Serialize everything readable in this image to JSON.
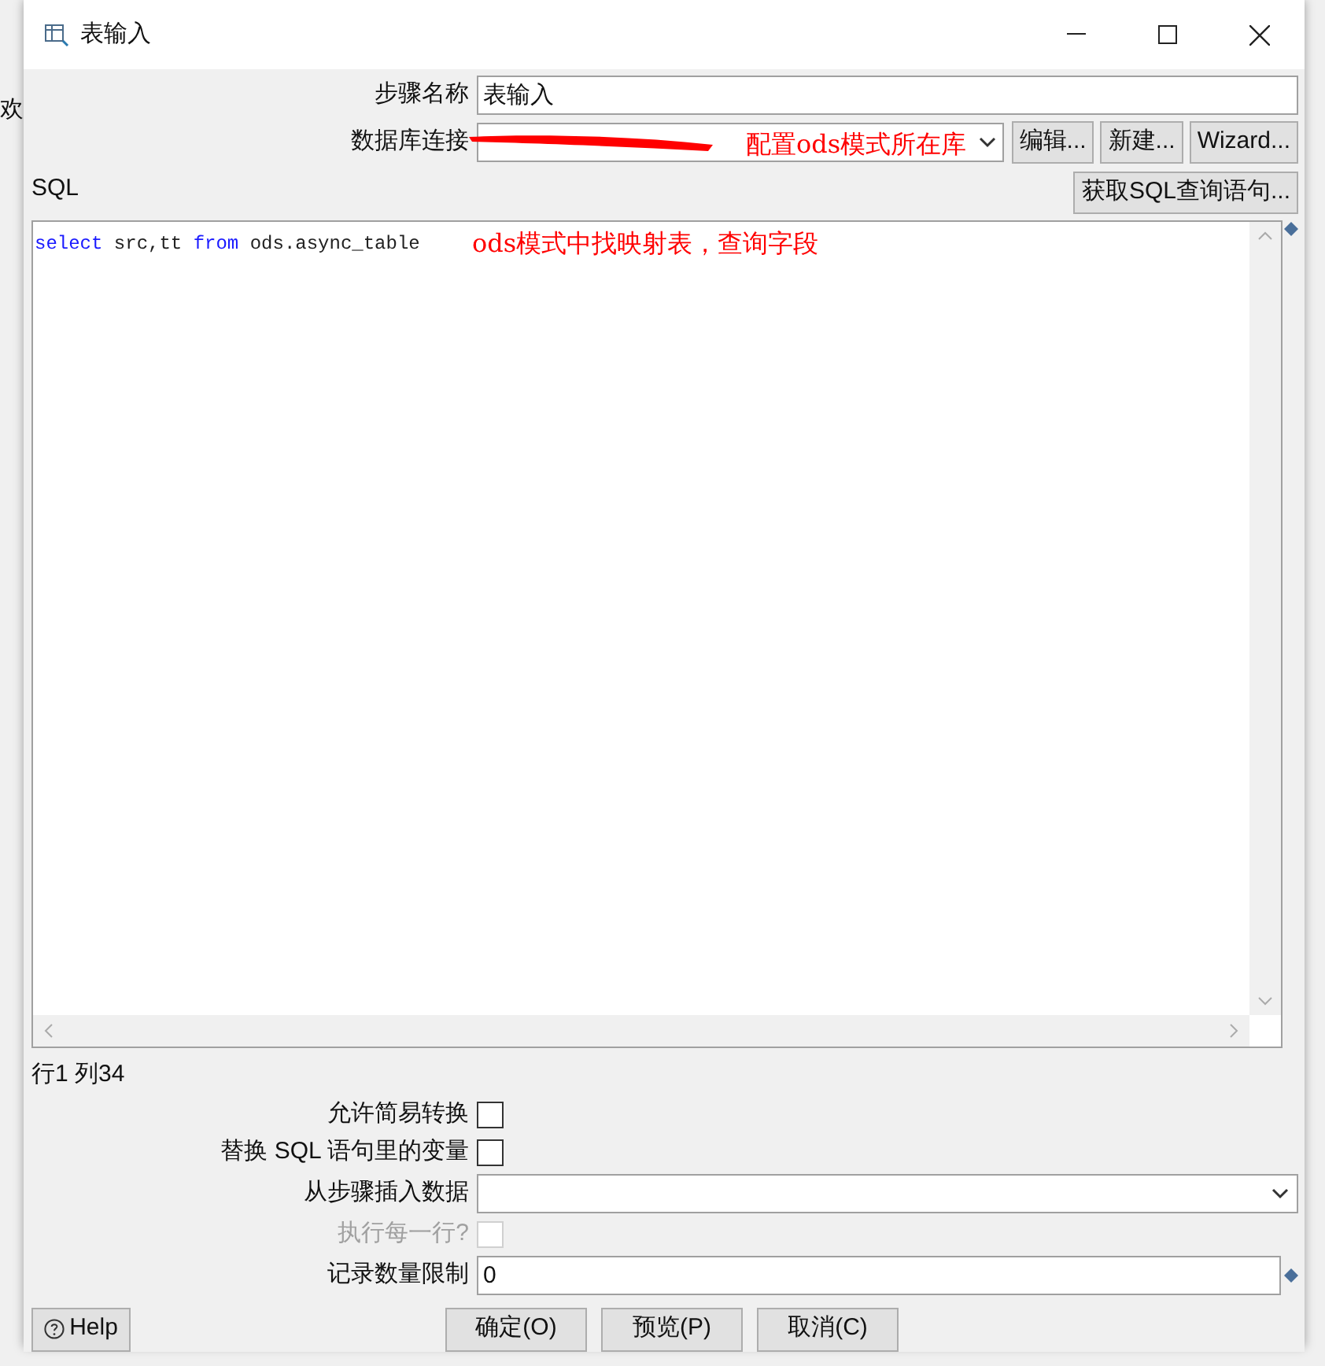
{
  "background": {
    "tab_label": "欢"
  },
  "window": {
    "title": "表输入",
    "controls": [
      {
        "kind": "minimize"
      },
      {
        "kind": "maximize"
      },
      {
        "kind": "close"
      }
    ]
  },
  "step_name": {
    "label": "步骤名称",
    "value": "表输入"
  },
  "connection": {
    "label": "数据库连接",
    "redacted": true,
    "annotation": "配置ods模式所在库",
    "buttons": [
      "编辑...",
      "新建...",
      "Wizard..."
    ]
  },
  "sql": {
    "label": "SQL",
    "get_button": "获取SQL查询语句...",
    "tokens": [
      {
        "kind": "keyword",
        "text": "select"
      },
      {
        "kind": "plain",
        "text": " src,tt "
      },
      {
        "kind": "keyword",
        "text": "from"
      },
      {
        "kind": "plain",
        "text": " ods.async_table"
      }
    ],
    "annotation": "ods模式中找映射表，查询字段"
  },
  "cursor_position": "行1 列34",
  "options": [
    {
      "kind": "checkbox",
      "label": "允许简易转换",
      "checked": false,
      "disabled": false
    },
    {
      "kind": "checkbox",
      "label": "替换 SQL 语句里的变量",
      "checked": false,
      "disabled": false
    },
    {
      "kind": "select",
      "label": "从步骤插入数据"
    },
    {
      "kind": "checkbox",
      "label": "执行每一行?",
      "checked": false,
      "disabled": true
    },
    {
      "kind": "input",
      "label": "记录数量限制",
      "value": "0"
    }
  ],
  "help_button": "Help",
  "buttons": [
    "确定(O)",
    "预览(P)",
    "取消(C)"
  ]
}
